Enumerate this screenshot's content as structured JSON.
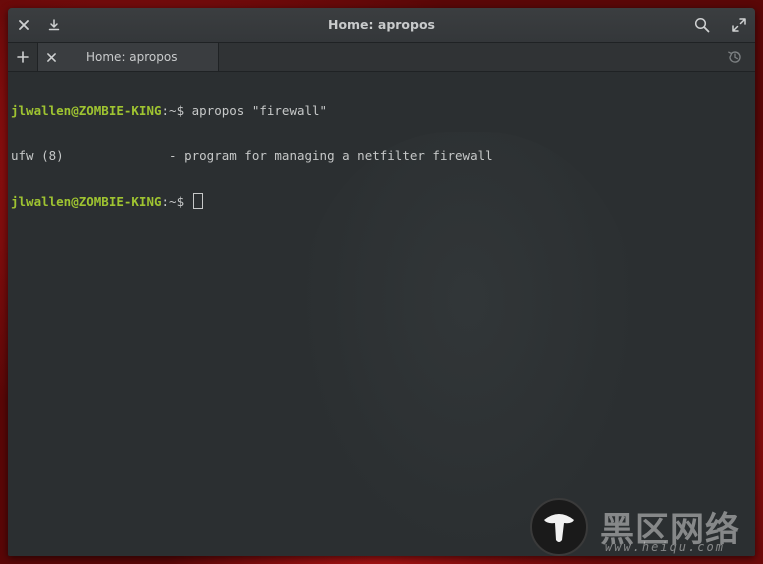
{
  "window": {
    "title": "Home: apropos"
  },
  "tabs": [
    {
      "label": "Home: apropos",
      "active": true
    }
  ],
  "terminal": {
    "lines": [
      {
        "user": "jlwallen@ZOMBIE-KING",
        "path": ":~$",
        "command": " apropos \"firewall\""
      },
      {
        "output": "ufw (8)              - program for managing a netfilter firewall"
      },
      {
        "user": "jlwallen@ZOMBIE-KING",
        "path": ":~$",
        "command": " "
      }
    ]
  },
  "watermark": {
    "text": "黑区网络",
    "url": "www.heiqu.com"
  },
  "icons": {
    "close": "close-icon",
    "download": "download-icon",
    "search": "search-icon",
    "fullscreen": "fullscreen-icon",
    "new_tab": "plus-icon",
    "tab_close": "close-icon",
    "history": "history-icon",
    "watermark_logo": "mushroom-logo-icon"
  },
  "colors": {
    "prompt_user": "#9fc431",
    "terminal_bg": "#2b2f31",
    "text": "#c6c8c8"
  }
}
